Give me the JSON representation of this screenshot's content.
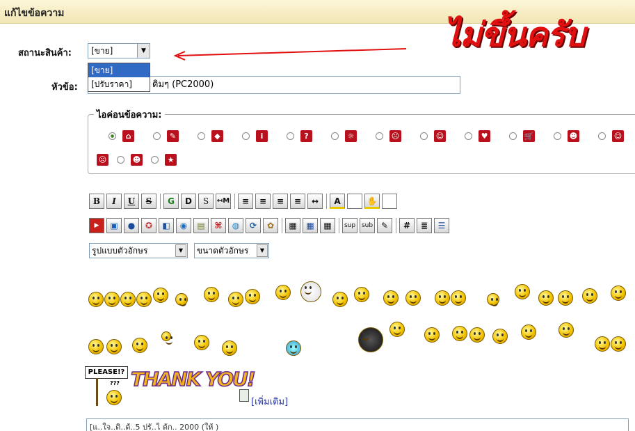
{
  "header": {
    "title": "แก้ไขข้อความ"
  },
  "annotation": {
    "text": "ไม่ขึ้นครับ"
  },
  "status_field": {
    "label": "สถานะสินค้า:",
    "value": "[ขาย]",
    "options": [
      "[ขาย]",
      "[ปรับราคา]"
    ]
  },
  "subject_field": {
    "label": "หัวข้อ:",
    "value_visible": "ดิมๆ (PC2000)"
  },
  "message_icons": {
    "legend": "ไอค่อนข้อความ:",
    "row1": [
      "⌂",
      "✎",
      "◆",
      "i",
      "?",
      "☼",
      "☹",
      "☺",
      "♥",
      "🛒",
      "☻",
      "☺"
    ],
    "row2": [
      "☹",
      "☻",
      "★"
    ]
  },
  "toolbar": {
    "row1": [
      "B",
      "I",
      "U",
      "S",
      "G",
      "D",
      "S",
      "↤M",
      "≡",
      "≡",
      "≡",
      "≡",
      "↔",
      "A",
      "",
      "✋",
      ""
    ],
    "row2": [
      "▶",
      "▣",
      "●",
      "✪",
      "◧",
      "◉",
      "▤",
      "⌘",
      "◍",
      "⟳",
      "✿",
      "▦",
      "▦",
      "▦",
      "sup",
      "sub",
      "✎",
      "#",
      "≣",
      "☰"
    ]
  },
  "font_select": {
    "value": "รูปแบบตัวอักษร"
  },
  "size_select": {
    "value": "ขนาดตัวอักษร"
  },
  "stickers": {
    "please": "PLEASE!?",
    "question": "???",
    "thank": "THANK YOU!"
  },
  "more_link": {
    "label": "[เพิ่มเติม]"
  },
  "message": {
    "value": "[แ..ใจ..ดิ..ด้..5 ปรั..ไ ด้ก.. 2000 (ให้ )"
  }
}
